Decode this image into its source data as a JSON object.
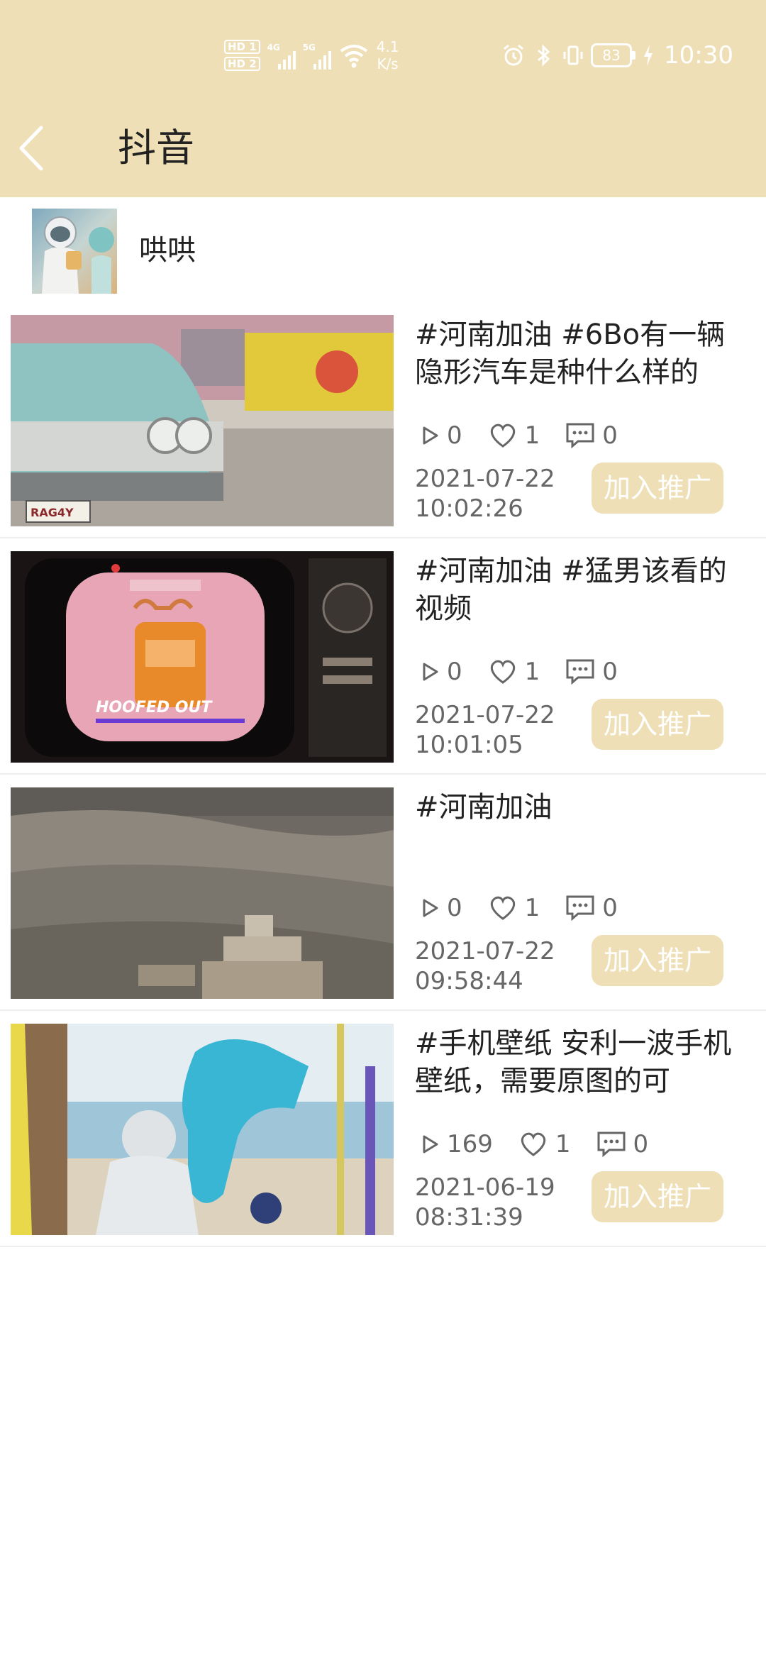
{
  "status_bar": {
    "hd1": "HD 1",
    "hd2": "HD 2",
    "net1": "4G",
    "net2": "5G",
    "speed_value": "4.1",
    "speed_unit": "K/s",
    "battery_level": "83",
    "time": "10:30"
  },
  "header": {
    "title": "抖音"
  },
  "user": {
    "name": "哄哄"
  },
  "videos": [
    {
      "title": "#河南加油 #6Bo有一辆隐形汽车是种什么样的",
      "plays": "0",
      "likes": "1",
      "comments": "0",
      "date": "2021-07-22",
      "time": "10:02:26",
      "button": "加入推广",
      "thumb_text": "RAG4Y"
    },
    {
      "title": "#河南加油 #猛男该看的视频",
      "plays": "0",
      "likes": "1",
      "comments": "0",
      "date": "2021-07-22",
      "time": "10:01:05",
      "button": "加入推广",
      "thumb_text": "HOOFED OUT"
    },
    {
      "title": "#河南加油",
      "plays": "0",
      "likes": "1",
      "comments": "0",
      "date": "2021-07-22",
      "time": "09:58:44",
      "button": "加入推广"
    },
    {
      "title": "#手机壁纸 安利一波手机壁纸，需要原图的可",
      "plays": "169",
      "likes": "1",
      "comments": "0",
      "date": "2021-06-19",
      "time": "08:31:39",
      "button": "加入推广"
    }
  ],
  "colors": {
    "accent": "#efdfb6",
    "text": "#222222",
    "muted": "#666666"
  }
}
